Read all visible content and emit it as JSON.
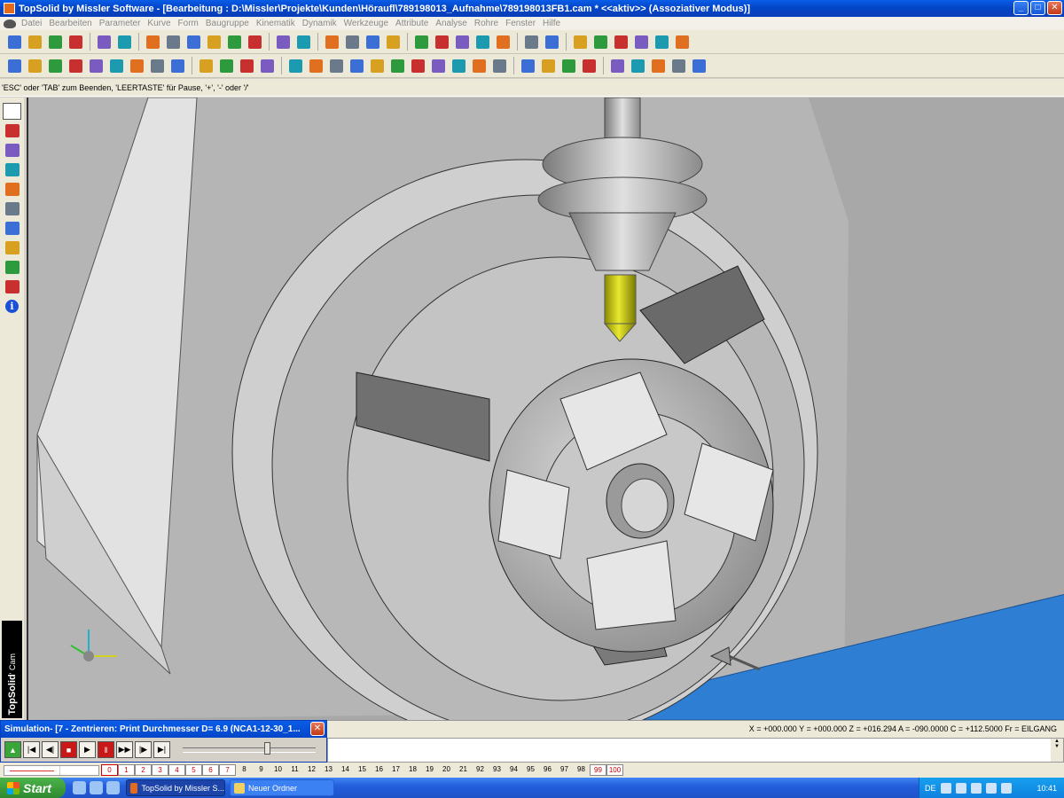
{
  "window": {
    "title": "TopSolid by Missler Software - [Bearbeitung : D:\\Missler\\Projekte\\Kunden\\Höraufl\\789198013_Aufnahme\\789198013FB1.cam *  <<aktiv>> (Assoziativer Modus)]",
    "minimize": "_",
    "maximize": "□",
    "close": "✕"
  },
  "menu": [
    "Datei",
    "Bearbeiten",
    "Parameter",
    "Kurve",
    "Form",
    "Baugruppe",
    "Kinematik",
    "Dynamik",
    "Werkzeuge",
    "Attribute",
    "Analyse",
    "Rohre",
    "Fenster",
    "Hilfe"
  ],
  "toolbar1": [
    "new-file-icon",
    "open-folder-icon",
    "save-icon",
    "print-icon",
    "delete-icon",
    "undo-icon",
    "redraw-icon",
    "zoom-tool-icon",
    "levels-icon",
    "tool-icon",
    "part-icon",
    "reset-icon",
    "cut-icon",
    "edit-curve-icon",
    "trim-icon",
    "columns-icon",
    "paragraph-icon",
    "wave-icon",
    "zoom-icon",
    "fit-icon",
    "view-icon",
    "camera-icon",
    "navigate-icon",
    "line-style-icon",
    "pattern-icon",
    "doc-icon",
    "library-icon",
    "notes-icon",
    "cam-doc-icon",
    "explode-icon",
    "cursor-icon"
  ],
  "toolbar2": [
    "pencil-icon",
    "point-icon",
    "segment-icon",
    "circle-point-icon",
    "rectangle-icon",
    "polyline-icon",
    "circle-icon",
    "ellipse-icon",
    "polygon-icon",
    "parallel-icon",
    "node-icon",
    "slot-icon",
    "shape-icon",
    "arc-icon",
    "fillet-icon",
    "box-icon",
    "profile-icon",
    "offset-icon",
    "spline-icon",
    "chain-icon",
    "curve-icon",
    "gear-icon",
    "sphere-icon",
    "cylinder-icon",
    "transform-icon",
    "mirror-icon",
    "scale-icon",
    "cancel-icon",
    "block-icon",
    "face-icon",
    "shading-icon",
    "hatch-icon",
    "ruler-icon"
  ],
  "hint": "'ESC' oder 'TAB' zum Beenden, 'LEERTASTE' für Pause, '+', '-' oder '/'",
  "lefttools": [
    "pencil-icon",
    "solid-icon",
    "cam-icon",
    "globe-icon",
    "milling-icon",
    "operations-icon",
    "tool-library-icon",
    "document-icon",
    "machine-icon",
    "kinematic-icon"
  ],
  "info_glyph": "i",
  "brand": {
    "name": "TopSolid",
    "suffix": "' Cam"
  },
  "simulation": {
    "title": "Simulation- [7 - Zentrieren: Print Durchmesser D= 6.9   (NCA1-12-30_1...",
    "close": "✕",
    "slider_position": 0.62
  },
  "coords": "X = +000.000   Y = +000.000   Z = +016.294   A = -090.0000   C = +112.5000   Fr = EILGANG",
  "layers": [
    "0",
    "1",
    "2",
    "3",
    "4",
    "5",
    "6",
    "7",
    "8",
    "9",
    "10",
    "11",
    "12",
    "13",
    "14",
    "15",
    "16",
    "17",
    "18",
    "19",
    "20",
    "21",
    "92",
    "93",
    "94",
    "95",
    "96",
    "97",
    "98",
    "99",
    "100"
  ],
  "taskbar": {
    "start": "Start",
    "task1": "TopSolid by Missler S...",
    "task2": "Neuer Ordner",
    "lang": "DE",
    "clock": "10:41"
  },
  "colors": {
    "tool_tip": "#c8c800",
    "floor": "#2e7fd4",
    "titlebar": "#0346c8"
  }
}
